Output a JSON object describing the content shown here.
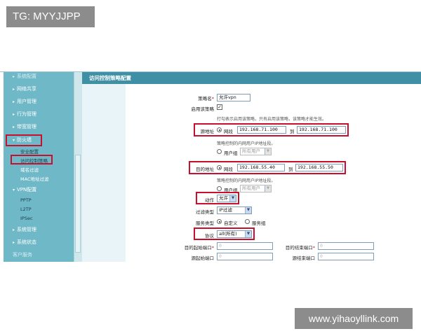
{
  "watermarks": {
    "top": "TG: MYYJJPP",
    "bottom": "www.yihaoyllink.com"
  },
  "sidebar": {
    "items": [
      {
        "label": "系统配置",
        "arrow": "▸"
      },
      {
        "label": "网络共享",
        "arrow": "▸"
      },
      {
        "label": "用户管理",
        "arrow": "▸"
      },
      {
        "label": "行为管理",
        "arrow": "▸"
      },
      {
        "label": "带宽管理",
        "arrow": "▸"
      },
      {
        "label": "防火墙",
        "arrow": "▾"
      },
      {
        "label": "安全配置"
      },
      {
        "label": "访问控制策略"
      },
      {
        "label": "域名过滤"
      },
      {
        "label": "MAC地址过滤"
      },
      {
        "label": "VPN配置",
        "arrow": "▾"
      },
      {
        "label": "PPTP"
      },
      {
        "label": "L2TP"
      },
      {
        "label": "IPSec"
      },
      {
        "label": "系统管理",
        "arrow": "▸"
      },
      {
        "label": "系统状态",
        "arrow": "▸"
      },
      {
        "label": "客户服务"
      }
    ]
  },
  "page": {
    "title": "访问控制策略配置"
  },
  "form": {
    "policy_name_label": "策略名",
    "policy_name_value": "允许vpn",
    "enable_label": "启用该策略",
    "enable_check": "✓",
    "enable_hint": "打勾表示启用该策略，只有启用该策略，该策略才能生效。",
    "src_label": "源地址",
    "src_mode": "网段",
    "src_start": "192.168.71.100",
    "to": "到",
    "src_end": "192.168.71.100",
    "src_hint": "策略控制的内网用户IP地址段。",
    "src_usergroup": "用户组",
    "src_usergroup_value": "所有用户",
    "dst_label": "目的地址",
    "dst_mode": "网段",
    "dst_start": "192.168.55.40",
    "dst_end": "192.168.55.50",
    "dst_hint": "策略控制的内网用户IP地址段。",
    "dst_usergroup": "用户组",
    "dst_usergroup_value": "所有用户",
    "action_label": "动作",
    "action_value": "允许",
    "filter_label": "过滤类型",
    "filter_value": "IP过滤",
    "service_label": "服务类型",
    "service_custom": "自定义",
    "service_group": "服务组",
    "protocol_label": "协议",
    "protocol_value": "all(所有)",
    "dst_start_port_label": "目的起始端口",
    "dst_start_port_value": "0",
    "dst_end_port_label": "目的结束端口",
    "dst_end_port_value": "0",
    "src_start_port_label": "源起始端口",
    "src_start_port_value": "0",
    "src_end_port_label": "源结束端口",
    "src_end_port_value": "0",
    "required_mark": "*",
    "dropdown_arrow": "▼"
  },
  "colors": {
    "sidebar": "#6fb8c8",
    "title_bar": "#3f8fa5",
    "highlight": "#c8102e"
  }
}
